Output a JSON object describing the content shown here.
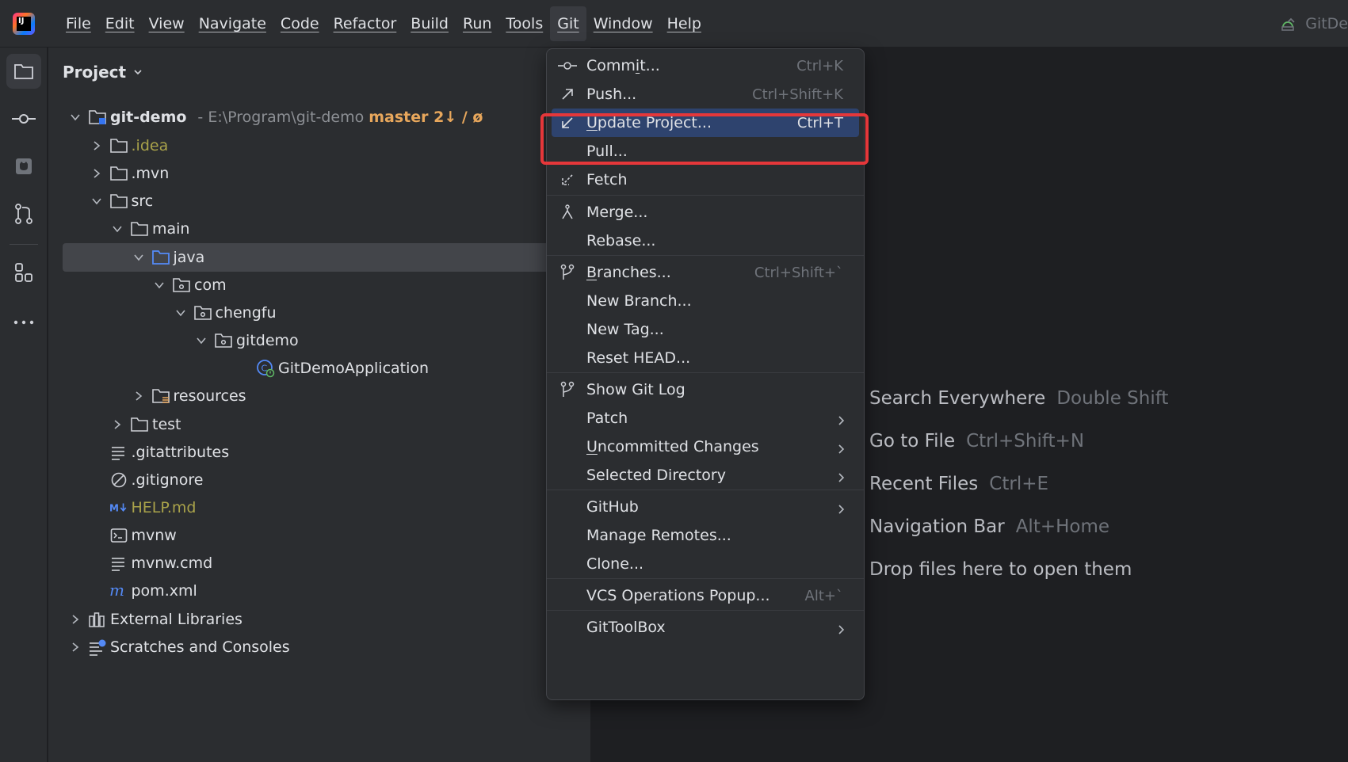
{
  "menubar": {
    "items": [
      "File",
      "Edit",
      "View",
      "Navigate",
      "Code",
      "Refactor",
      "Build",
      "Run",
      "Tools",
      "Git",
      "Window",
      "Help"
    ],
    "active": "Git",
    "right_label": "GitDe"
  },
  "project_panel": {
    "title": "Project",
    "root": {
      "name": "git-demo",
      "path": "- E:\\Program\\git-demo",
      "branch": "master 2↓ / ø"
    },
    "tree": [
      {
        "label": ".idea",
        "depth": 1,
        "chevron": "right",
        "icon": "folder-icon",
        "style": "olive"
      },
      {
        "label": ".mvn",
        "depth": 1,
        "chevron": "right",
        "icon": "folder-icon",
        "style": ""
      },
      {
        "label": "src",
        "depth": 1,
        "chevron": "down",
        "icon": "folder-icon",
        "style": ""
      },
      {
        "label": "main",
        "depth": 2,
        "chevron": "down",
        "icon": "folder-icon",
        "style": ""
      },
      {
        "label": "java",
        "depth": 3,
        "chevron": "down",
        "icon": "source-folder-icon",
        "style": "",
        "selected": true
      },
      {
        "label": "com",
        "depth": 4,
        "chevron": "down",
        "icon": "package-icon",
        "style": ""
      },
      {
        "label": "chengfu",
        "depth": 5,
        "chevron": "down",
        "icon": "package-icon",
        "style": ""
      },
      {
        "label": "gitdemo",
        "depth": 6,
        "chevron": "down",
        "icon": "package-icon",
        "style": ""
      },
      {
        "label": "GitDemoApplication",
        "depth": 8,
        "chevron": "none",
        "icon": "spring-class-icon",
        "style": ""
      },
      {
        "label": "resources",
        "depth": 3,
        "chevron": "right",
        "icon": "resources-folder-icon",
        "style": ""
      },
      {
        "label": "test",
        "depth": 2,
        "chevron": "right",
        "icon": "folder-icon",
        "style": ""
      },
      {
        "label": ".gitattributes",
        "depth": 1,
        "chevron": "none",
        "icon": "text-file-icon",
        "style": ""
      },
      {
        "label": ".gitignore",
        "depth": 1,
        "chevron": "none",
        "icon": "ignore-file-icon",
        "style": ""
      },
      {
        "label": "HELP.md",
        "depth": 1,
        "chevron": "none",
        "icon": "markdown-icon",
        "style": "olive"
      },
      {
        "label": "mvnw",
        "depth": 1,
        "chevron": "none",
        "icon": "shell-script-icon",
        "style": ""
      },
      {
        "label": "mvnw.cmd",
        "depth": 1,
        "chevron": "none",
        "icon": "text-file-icon",
        "style": ""
      },
      {
        "label": "pom.xml",
        "depth": 1,
        "chevron": "none",
        "icon": "maven-icon",
        "style": ""
      },
      {
        "label": "External Libraries",
        "depth": 0,
        "chevron": "right",
        "icon": "library-icon",
        "style": ""
      },
      {
        "label": "Scratches and Consoles",
        "depth": 0,
        "chevron": "right",
        "icon": "scratches-icon",
        "style": ""
      }
    ]
  },
  "git_menu": {
    "items": [
      {
        "label": "Commit...",
        "shortcut": "Ctrl+K",
        "icon": "commit-icon",
        "submenu": false
      },
      {
        "label": "Push...",
        "shortcut": "Ctrl+Shift+K",
        "icon": "push-icon",
        "submenu": false
      },
      {
        "label": "Update Project...",
        "shortcut": "Ctrl+T",
        "icon": "update-icon",
        "submenu": false,
        "highlighted": true
      },
      {
        "label": "Pull...",
        "shortcut": "",
        "icon": "",
        "submenu": false
      },
      {
        "label": "Fetch",
        "shortcut": "",
        "icon": "fetch-icon",
        "submenu": false
      },
      {
        "label": "Merge...",
        "shortcut": "",
        "icon": "merge-icon",
        "submenu": false
      },
      {
        "label": "Rebase...",
        "shortcut": "",
        "icon": "",
        "submenu": false
      },
      {
        "label": "Branches...",
        "shortcut": "Ctrl+Shift+`",
        "icon": "branches-icon",
        "submenu": false
      },
      {
        "label": "New Branch...",
        "shortcut": "",
        "icon": "",
        "submenu": false
      },
      {
        "label": "New Tag...",
        "shortcut": "",
        "icon": "",
        "submenu": false
      },
      {
        "label": "Reset HEAD...",
        "shortcut": "",
        "icon": "",
        "submenu": false
      },
      {
        "label": "Show Git Log",
        "shortcut": "",
        "icon": "git-log-icon",
        "submenu": false
      },
      {
        "label": "Patch",
        "shortcut": "",
        "icon": "",
        "submenu": true
      },
      {
        "label": "Uncommitted Changes",
        "shortcut": "",
        "icon": "",
        "submenu": true
      },
      {
        "label": "Selected Directory",
        "shortcut": "",
        "icon": "",
        "submenu": true
      },
      {
        "label": "GitHub",
        "shortcut": "",
        "icon": "",
        "submenu": true
      },
      {
        "label": "Manage Remotes...",
        "shortcut": "",
        "icon": "",
        "submenu": false
      },
      {
        "label": "Clone...",
        "shortcut": "",
        "icon": "",
        "submenu": false
      },
      {
        "label": "VCS Operations Popup...",
        "shortcut": "Alt+`",
        "icon": "",
        "submenu": false
      },
      {
        "label": "GitToolBox",
        "shortcut": "",
        "icon": "",
        "submenu": true
      }
    ]
  },
  "editor_hints": [
    {
      "label": "Search Everywhere",
      "shortcut": "Double Shift"
    },
    {
      "label": "Go to File",
      "shortcut": "Ctrl+Shift+N"
    },
    {
      "label": "Recent Files",
      "shortcut": "Ctrl+E"
    },
    {
      "label": "Navigation Bar",
      "shortcut": "Alt+Home"
    },
    {
      "label": "Drop files here to open them",
      "shortcut": ""
    }
  ],
  "colors": {
    "highlight": "#2e436e",
    "annotation_box": "#e5373a",
    "branch_text": "#e8a75c",
    "untracked_text": "#a9a24a"
  }
}
